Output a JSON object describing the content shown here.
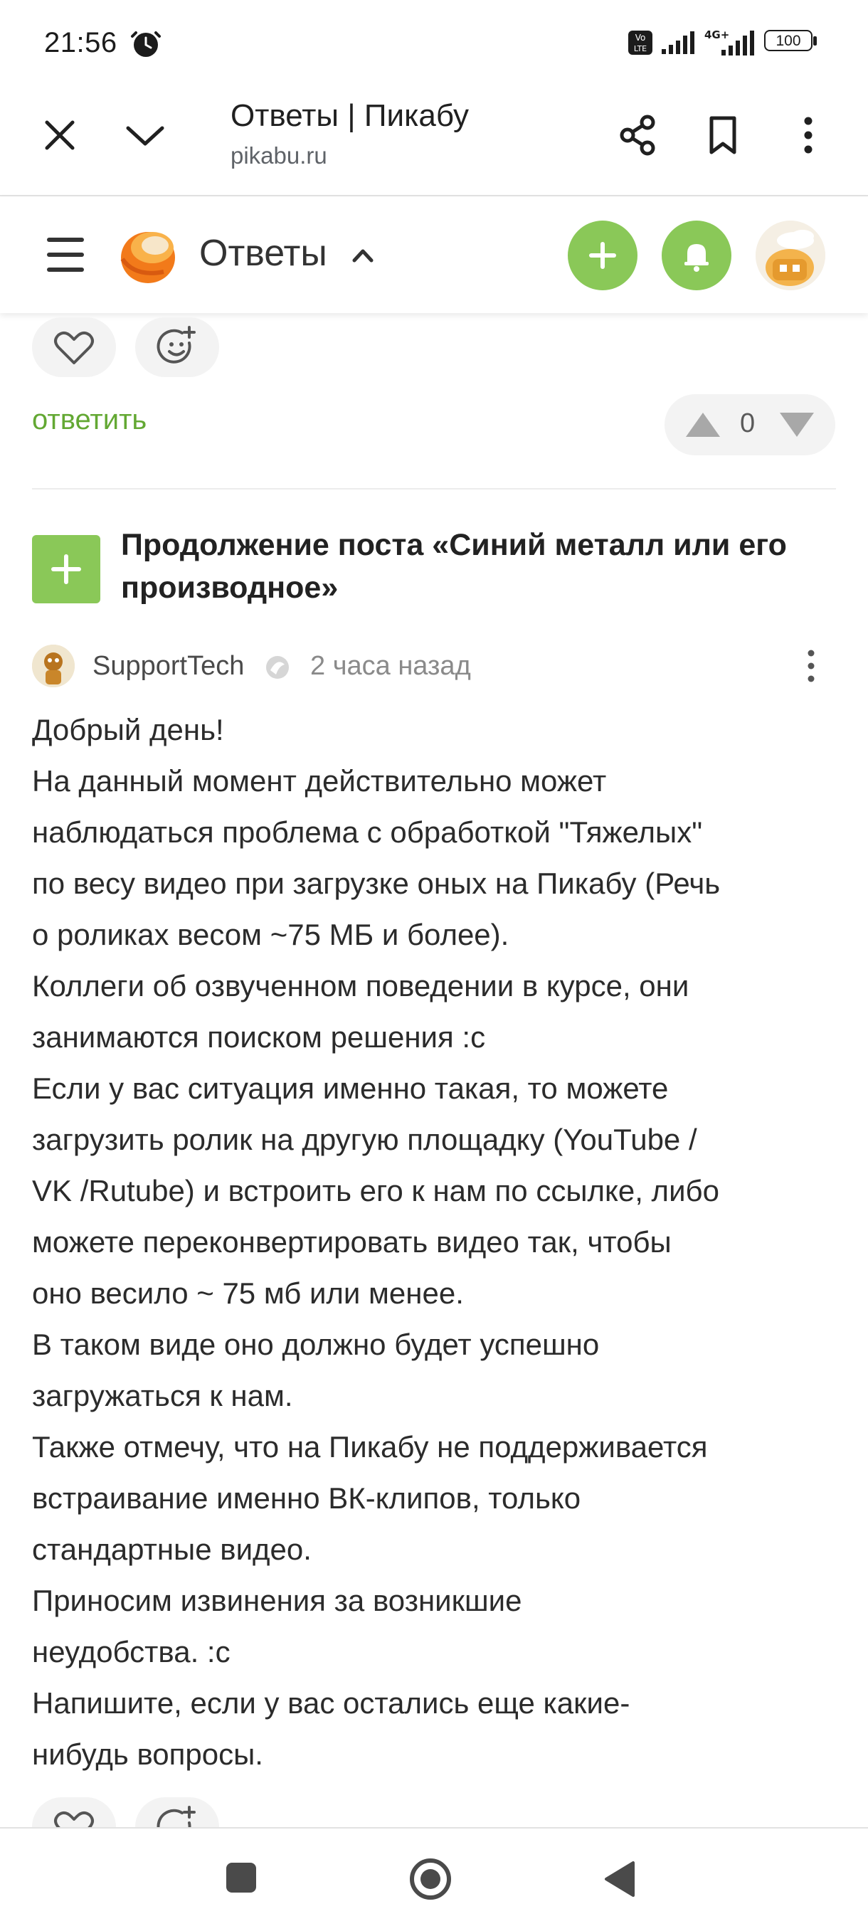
{
  "status_bar": {
    "time": "21:56",
    "battery": "100",
    "network": "4G+",
    "icons": [
      "alarm-icon",
      "volte-icon",
      "signal-icon",
      "battery-icon"
    ]
  },
  "browser": {
    "title": "Ответы | Пикабу",
    "url": "pikabu.ru",
    "icons": [
      "close-icon",
      "chevron-down-icon",
      "share-icon",
      "bookmark-icon",
      "more-vertical-icon"
    ]
  },
  "site_header": {
    "section_title": "Ответы",
    "icons": [
      "menu-icon",
      "pikabu-logo",
      "chevron-up-icon",
      "plus-icon",
      "bell-icon",
      "avatar"
    ]
  },
  "post_actions": {
    "reply_label": "ответить",
    "rating": "0"
  },
  "continuation": {
    "title_lines": [
      "Продолжение поста «Синий металл или его",
      "производное»"
    ]
  },
  "comment": {
    "author": "SupportTech",
    "time": "2 часа назад",
    "lines": [
      "Добрый день!",
      "На данный момент действительно может",
      "наблюдаться проблема с обработкой \"Тяжелых\"",
      "по весу видео при загрузке оных на Пикабу (Речь",
      "о роликах весом ~75 МБ и более).",
      "Коллеги об озвученном поведении в курсе, они",
      "занимаются поиском решения :с",
      "Если у вас ситуация именно такая, то можете",
      "загрузить ролик на другую площадку (YouTube /",
      "VK /Rutube) и встроить его к нам по ссылке, либо",
      "можете переконвертировать видео так, чтобы",
      "оно весило ~ 75 мб или менее.",
      "В таком виде оно должно будет успешно",
      "загружаться к нам.",
      "Также отмечу, что на Пикабу не поддерживается",
      "встраивание именно ВК-клипов, только",
      "стандартные видео.",
      "Приносим извинения за возникшие",
      "неудобства. :с",
      "Напишите, если у вас остались еще какие-",
      "нибудь вопросы."
    ]
  },
  "colors": {
    "accent_green": "#8ac858",
    "link_green": "#63a833",
    "text": "#2b2b2b",
    "muted": "#8a8a8a"
  },
  "nav_bar": {
    "icons": [
      "recents-square-icon",
      "home-circle-icon",
      "back-triangle-icon"
    ]
  }
}
